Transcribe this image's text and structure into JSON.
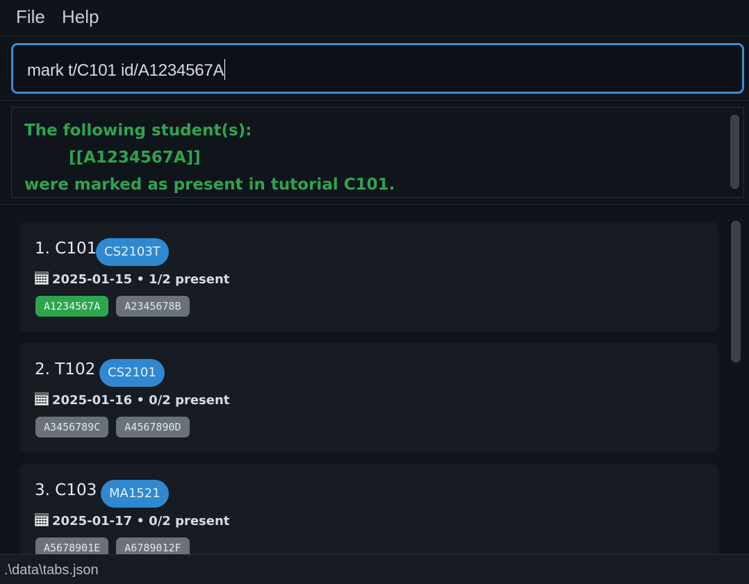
{
  "menu": {
    "file_label": "File",
    "help_label": "Help"
  },
  "command": {
    "value": "mark t/C101 id/A1234567A"
  },
  "result": {
    "text": "The following student(s):\n        [[A1234567A]]\nwere marked as present in tutorial C101."
  },
  "tutorials": [
    {
      "title": "1.  C101",
      "course": "CS2103T",
      "date_line": "2025-01-15 • 1/2 present",
      "students": [
        {
          "id": "A1234567A",
          "status": "present"
        },
        {
          "id": "A2345678B",
          "status": "absent"
        }
      ]
    },
    {
      "title": "2.  T102",
      "course": "CS2101",
      "date_line": "2025-01-16 • 0/2 present",
      "students": [
        {
          "id": "A3456789C",
          "status": "absent"
        },
        {
          "id": "A4567890D",
          "status": "absent"
        }
      ]
    },
    {
      "title": "3.  C103",
      "course": "MA1521",
      "date_line": "2025-01-17 • 0/2 present",
      "students": [
        {
          "id": "A5678901E",
          "status": "absent"
        },
        {
          "id": "A6789012F",
          "status": "absent"
        }
      ]
    }
  ],
  "status_bar": {
    "path": ".\\data\\tabs.json"
  },
  "colors": {
    "accent": "#3c8ed6",
    "success": "#2ea44f",
    "course_badge": "#2f88d0",
    "absent_tag": "#6a717b"
  }
}
